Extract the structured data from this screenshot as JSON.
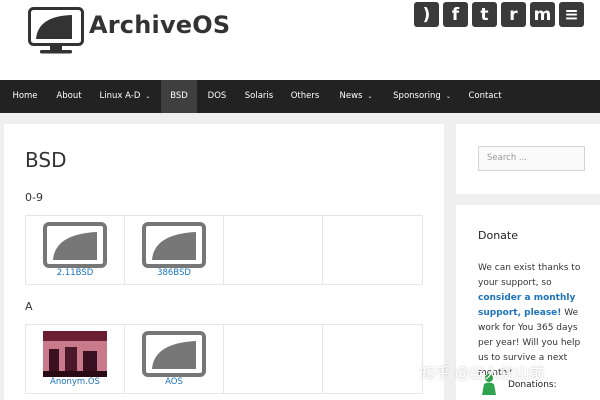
{
  "header": {
    "site_title": "ArchiveOS",
    "social": [
      {
        "icon": "rss-icon",
        "glyph": ")"
      },
      {
        "icon": "facebook-icon",
        "glyph": "f"
      },
      {
        "icon": "twitter-icon",
        "glyph": "t"
      },
      {
        "icon": "reddit-icon",
        "glyph": "r"
      },
      {
        "icon": "mastodon-icon",
        "glyph": "m"
      },
      {
        "icon": "feed-icon",
        "glyph": "≡"
      }
    ]
  },
  "nav": {
    "items": [
      "Home",
      "About",
      "Linux A-D",
      "BSD",
      "DOS",
      "Solaris",
      "Others",
      "News",
      "Sponsoring",
      "Contact"
    ],
    "dropdown_caret": "⌄"
  },
  "main": {
    "title": "BSD",
    "sections": [
      {
        "label": "0-9",
        "items": [
          "2.11BSD",
          "386BSD"
        ]
      },
      {
        "label": "A",
        "items": [
          "Anonym.OS",
          "AOS"
        ]
      }
    ]
  },
  "sidebar": {
    "search_placeholder": "Search ...",
    "donate": {
      "title": "Donate",
      "text_before": "We can exist thanks to your support, so ",
      "text_bold": "consider a monthly support, please!",
      "text_after": " We work for You 365 days per year! Will you help us to survive a next month?",
      "donations_label": "Donations:"
    }
  },
  "watermark": "知乎 @出入住山前",
  "colors": {
    "nav_bg": "#222222",
    "nav_active": "#3f3f3f",
    "link": "#1e73be",
    "page_bg": "#efefef"
  }
}
